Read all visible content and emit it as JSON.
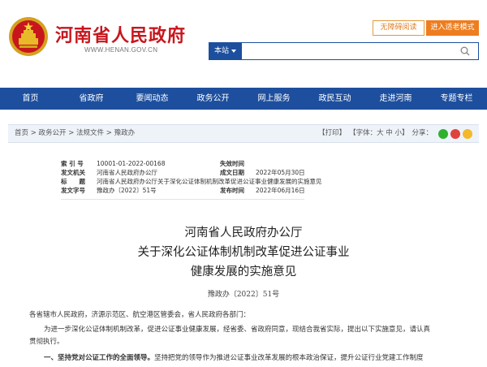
{
  "header": {
    "site_title": "河南省人民政府",
    "site_domain": "WWW.HENAN.GOV.CN",
    "btn_barrier_free": "无障碍阅读",
    "btn_elder_mode": "进入适老模式",
    "search_scope": "本站",
    "search_placeholder": ""
  },
  "nav": [
    "首页",
    "省政府",
    "要闻动态",
    "政务公开",
    "网上服务",
    "政民互动",
    "走进河南",
    "专题专栏"
  ],
  "breadcrumb": "首页 > 政务公开 > 法规文件 > 豫政办",
  "tools": {
    "print": "【打印】",
    "font": "【字体：大 中 小】",
    "share": "分享："
  },
  "meta": {
    "index_label": "索 引 号",
    "index_value": "10001-01-2022-00168",
    "validity_label": "失效时间",
    "validity_value": "",
    "issuer_label": "发文机关",
    "issuer_value": "河南省人民政府办公厅",
    "created_label": "成文日期",
    "created_value": "2022年05月30日",
    "title_label": "标　　题",
    "title_value": "河南省人民政府办公厅关于深化公证体制机制改革促进公证事业健康发展的实施意见",
    "docno_label": "发文字号",
    "docno_value": "豫政办〔2022〕51号",
    "published_label": "发布时间",
    "published_value": "2022年06月16日"
  },
  "article": {
    "title_line1": "河南省人民政府办公厅",
    "title_line2": "关于深化公证体制机制改革促进公证事业",
    "title_line3": "健康发展的实施意见",
    "doc_number": "豫政办〔2022〕51号",
    "addressees": "各省辖市人民政府，济源示范区、航空港区管委会，省人民政府各部门：",
    "intro_line1": "为进一步深化公证体制机制改革，促进公证事业健康发展，经省委、省政府同意，现结合我省实际，提出以下实施意见，请认真",
    "intro_line2": "贯彻执行。",
    "section1_heading": "一、坚持党对公证工作的全面领导。",
    "section1_text": "坚持把党的领导作为推进公证事业改革发展的根本政治保证，提升公证行业党建工作制度"
  }
}
